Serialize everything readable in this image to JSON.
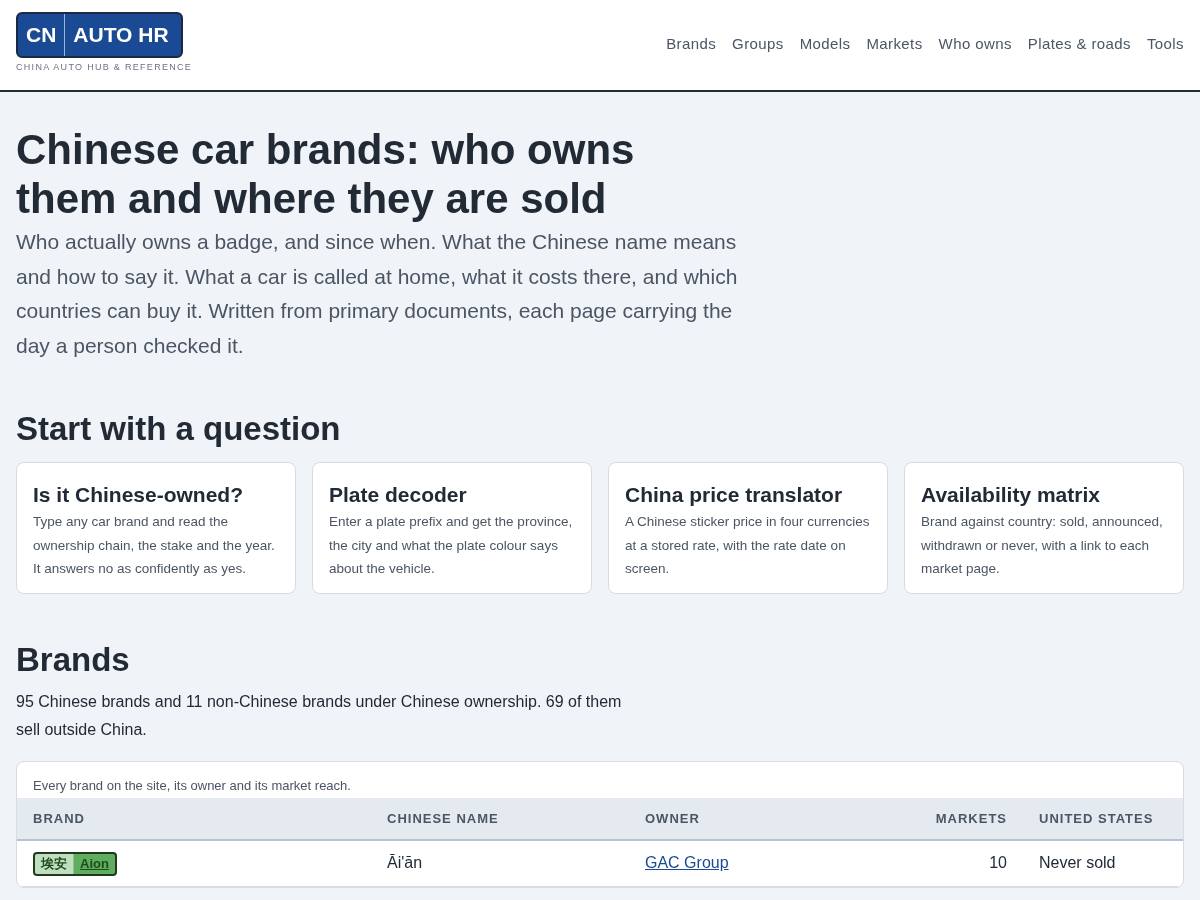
{
  "logo": {
    "left": "CN",
    "right": "AUTO HR",
    "tagline": "CHINA AUTO HUB & REFERENCE"
  },
  "nav": [
    "Brands",
    "Groups",
    "Models",
    "Markets",
    "Who owns",
    "Plates & roads",
    "Tools"
  ],
  "hero": {
    "title": "Chinese car brands: who owns them and where they are sold",
    "intro": "Who actually owns a badge, and since when. What the Chinese name means and how to say it. What a car is called at home, what it costs there, and which countries can buy it. Written from primary documents, each page carrying the day a person checked it."
  },
  "questions": {
    "heading": "Start with a question",
    "cards": [
      {
        "title": "Is it Chinese-owned?",
        "text": "Type any car brand and read the ownership chain, the stake and the year. It answers no as confidently as yes."
      },
      {
        "title": "Plate decoder",
        "text": "Enter a plate prefix and get the province, the city and what the plate colour says about the vehicle."
      },
      {
        "title": "China price translator",
        "text": "A Chinese sticker price in four currencies at a stored rate, with the rate date on screen."
      },
      {
        "title": "Availability matrix",
        "text": "Brand against country: sold, announced, withdrawn or never, with a link to each market page."
      }
    ]
  },
  "brands": {
    "heading": "Brands",
    "summary": "95 Chinese brands and 11 non-Chinese brands under Chinese ownership. 69 of them sell outside China.",
    "table": {
      "caption": "Every brand on the site, its owner and its market reach.",
      "columns": [
        "BRAND",
        "CHINESE NAME",
        "OWNER",
        "MARKETS",
        "UNITED STATES"
      ],
      "rows": [
        {
          "brand_cn": "埃安",
          "brand": "Aion",
          "color": "#5fae5f",
          "chinese_name": "Āi'ān",
          "owner": "GAC Group",
          "markets": "10",
          "united_states": "Never sold"
        }
      ]
    }
  }
}
